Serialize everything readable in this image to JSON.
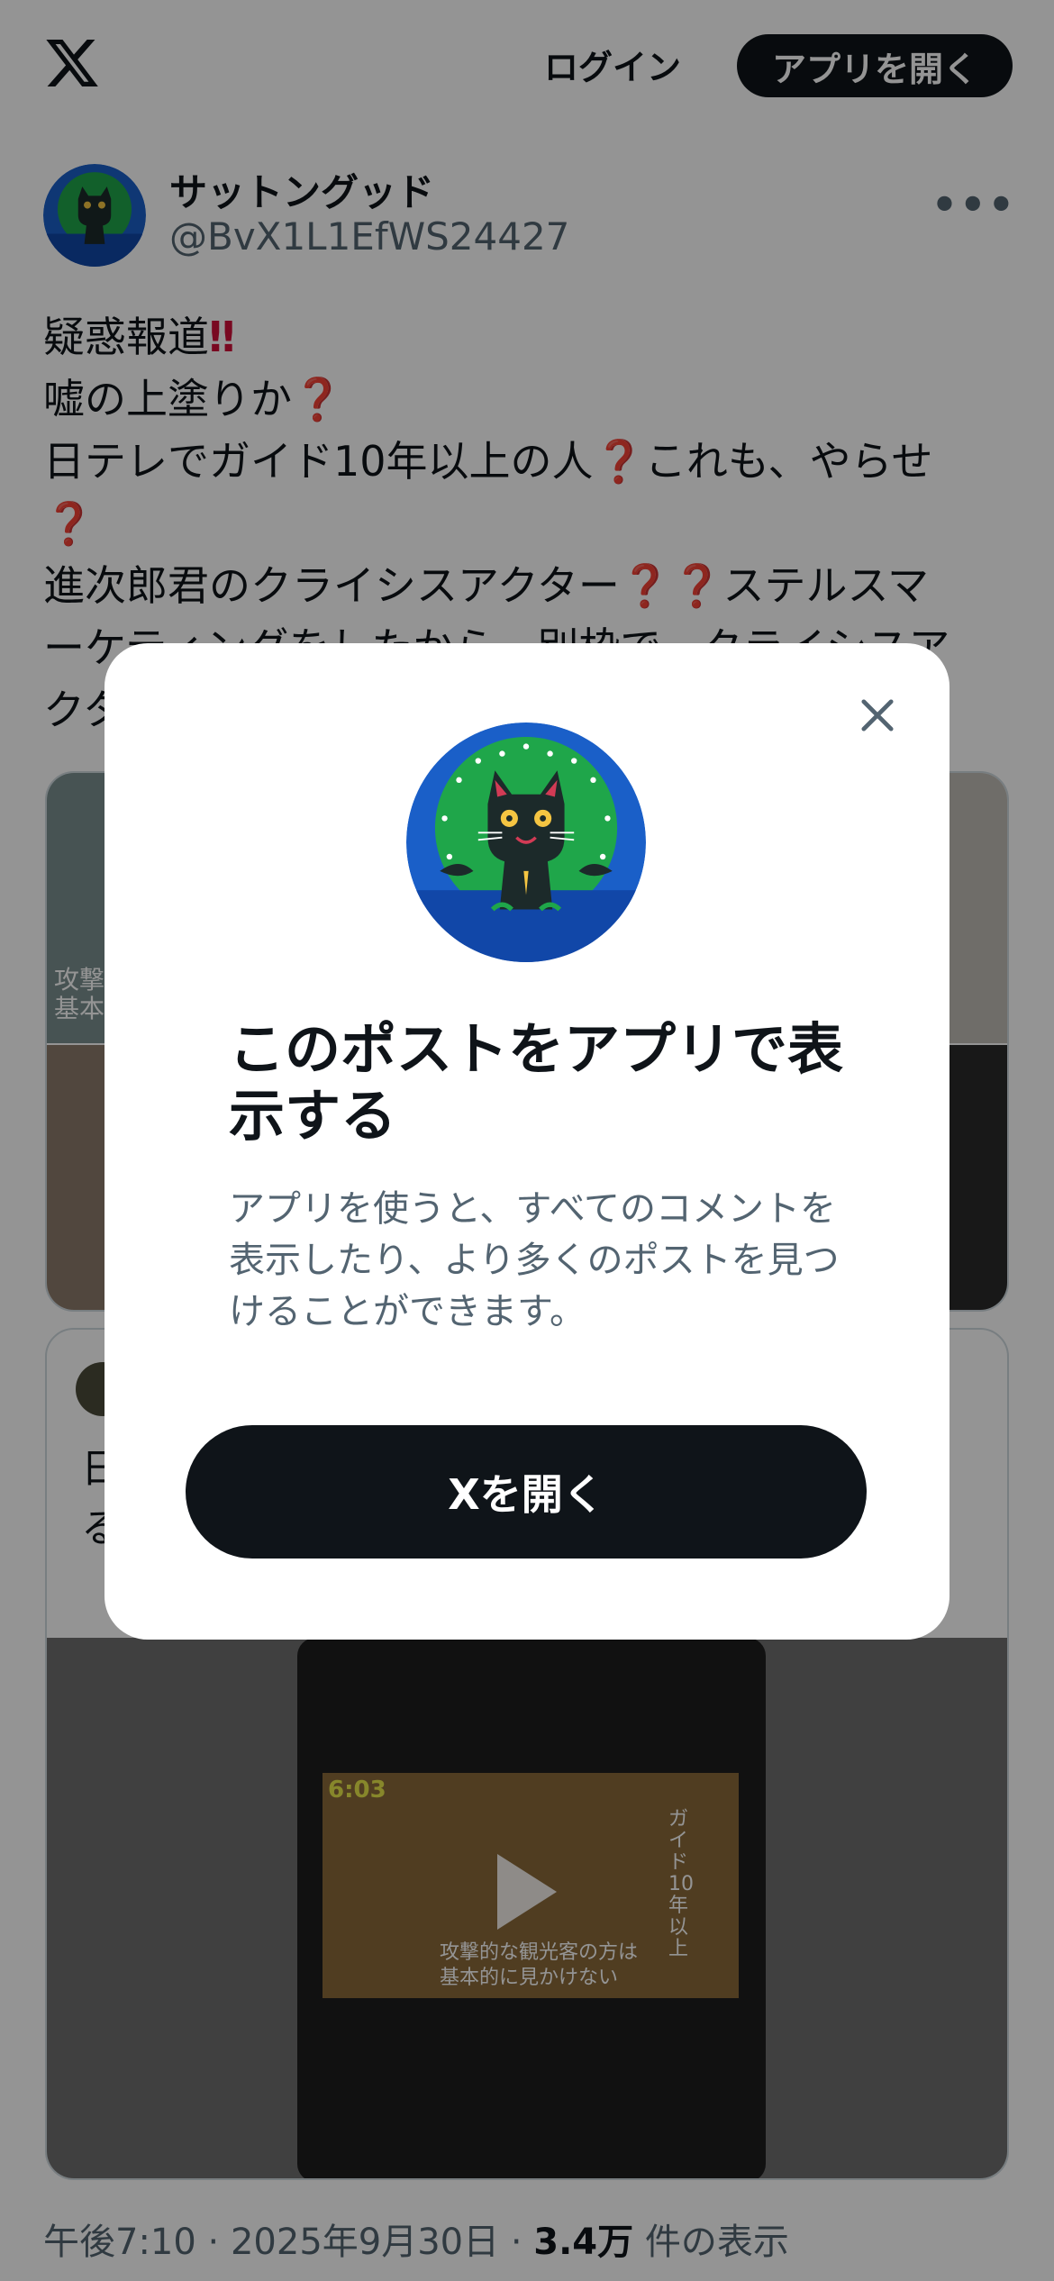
{
  "header": {
    "logo_icon": "x-logo-icon",
    "login_label": "ログイン",
    "open_app_label": "アプリを開く"
  },
  "post": {
    "author_name": "サットングッド",
    "author_handle": "@BvX1L1EfWS24427",
    "more_label": "•••",
    "lines": [
      "疑惑報道",
      "嘘の上塗りか",
      "日テレでガイド10年以上の人",
      "これも、やらせ",
      "進次郎君のクライシスアクター",
      "ステルスマ",
      "ーケティングをしたから、別枠で、クライシスア",
      "クター"
    ],
    "timestamp": "午後7:10 · 2025年9月30日 · ",
    "views_count": "3.4万",
    "views_label": " 件の表示"
  },
  "media": {
    "caption_1": "攻撃的",
    "caption_2": "基本的",
    "video_caption_1": "攻撃的な観光客の方は",
    "video_caption_2": "基本的に見かけない",
    "video_clock": "6:03",
    "video_side_caption": "ガイド10年以上"
  },
  "quote": {
    "line_1": "日",
    "line_2": "る"
  },
  "modal": {
    "title": "このポストをアプリで表示する",
    "description": "アプリを使うと、すべてのコメントを表示したり、より多くのポストを見つけることができます。",
    "button_label": "Xを開く",
    "close_icon": "close-icon"
  },
  "colors": {
    "text_primary": "#0f1419",
    "text_secondary": "#536471",
    "emoji_red": "#d0103a",
    "avatar_blue": "#1a5fc8",
    "avatar_green": "#1fa64a"
  }
}
